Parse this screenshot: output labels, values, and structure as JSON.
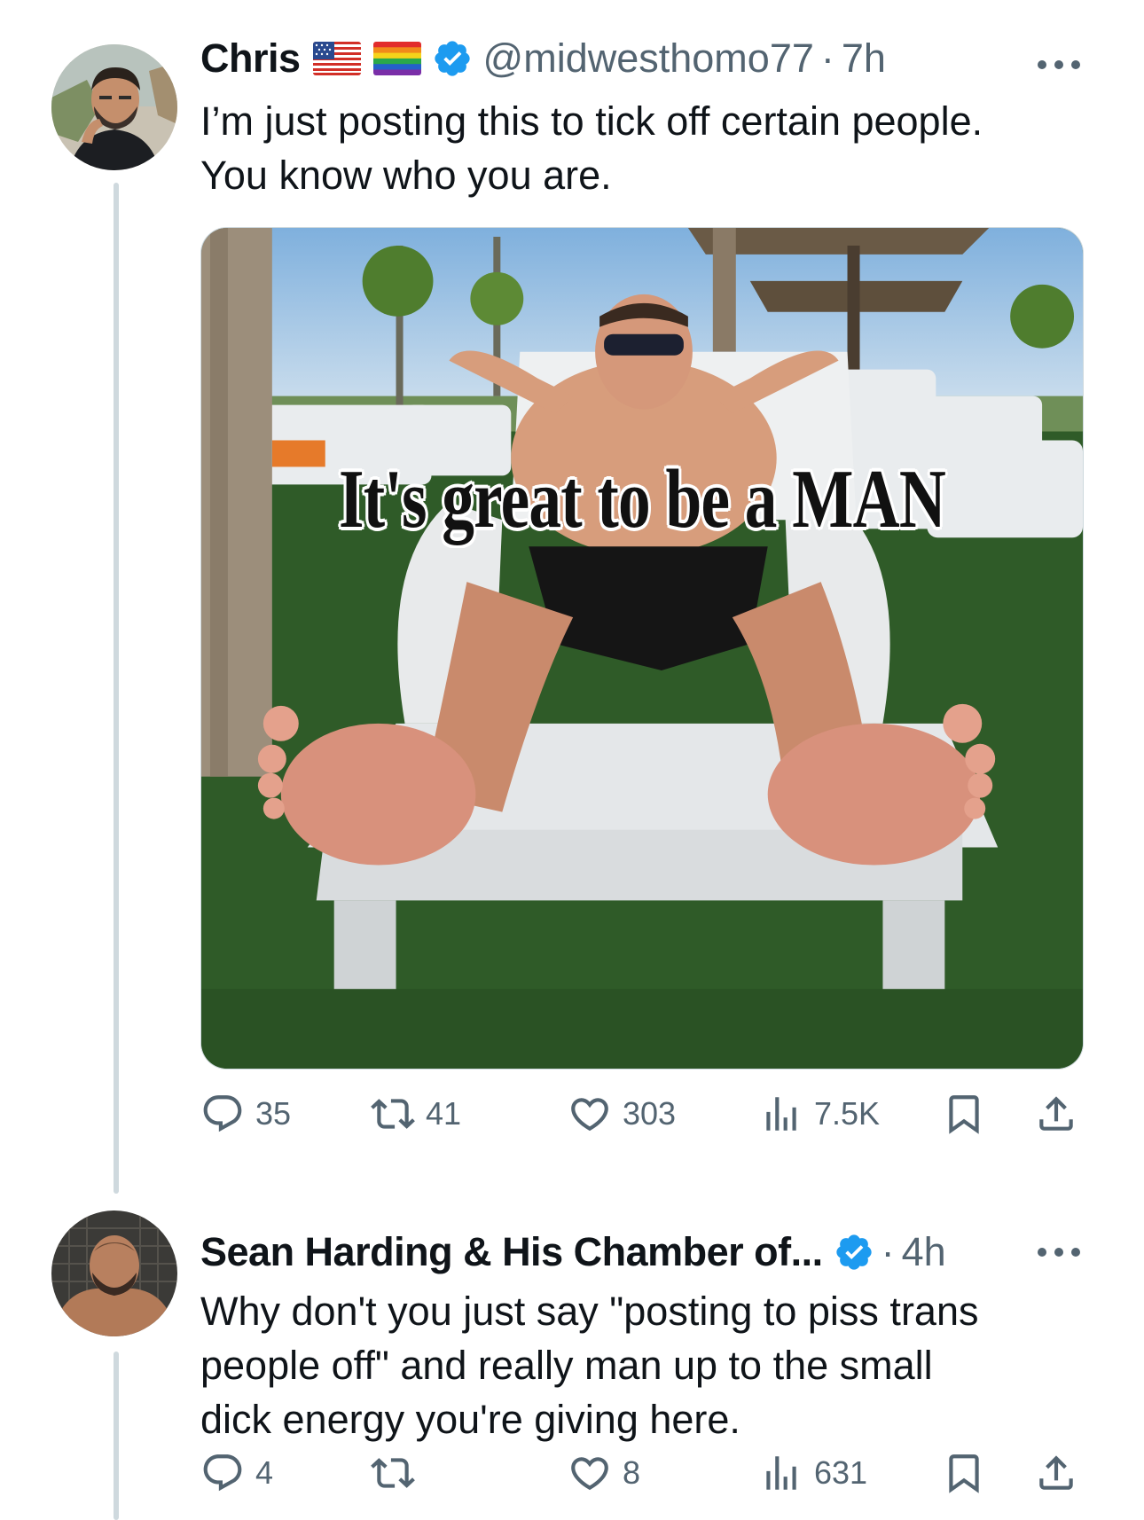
{
  "tweets": [
    {
      "name": "Chris",
      "handle": "@midwesthomo77",
      "dot": "·",
      "time": "7h",
      "text_line1": "I’m just posting this to tick off certain people.",
      "text_line2": "You know who you are.",
      "media": {
        "caption": "It's great to be a MAN"
      },
      "replies": "35",
      "reposts": "41",
      "likes": "303",
      "views": "7.5K"
    },
    {
      "name": "Sean Harding & His Chamber of...",
      "dot": "·",
      "time": "4h",
      "text_line1": "Why don't you just say \"posting to piss trans",
      "text_line2": "people off\" and really man up to the small",
      "text_line3": "dick energy you're giving here.",
      "replies": "4",
      "reposts": "",
      "likes": "8",
      "views": "631"
    }
  ],
  "icons": {
    "reply": "speech-bubble",
    "repost": "two-arrows-loop",
    "like": "heart",
    "views": "bar-chart",
    "bookmark": "bookmark",
    "share": "upload-arrow",
    "verified": "blue-check-badge",
    "more": "ellipsis"
  },
  "colors": {
    "text": "#0f1419",
    "secondary": "#536471",
    "verified": "#1d9bf0",
    "thread_line": "#cfd9de"
  }
}
